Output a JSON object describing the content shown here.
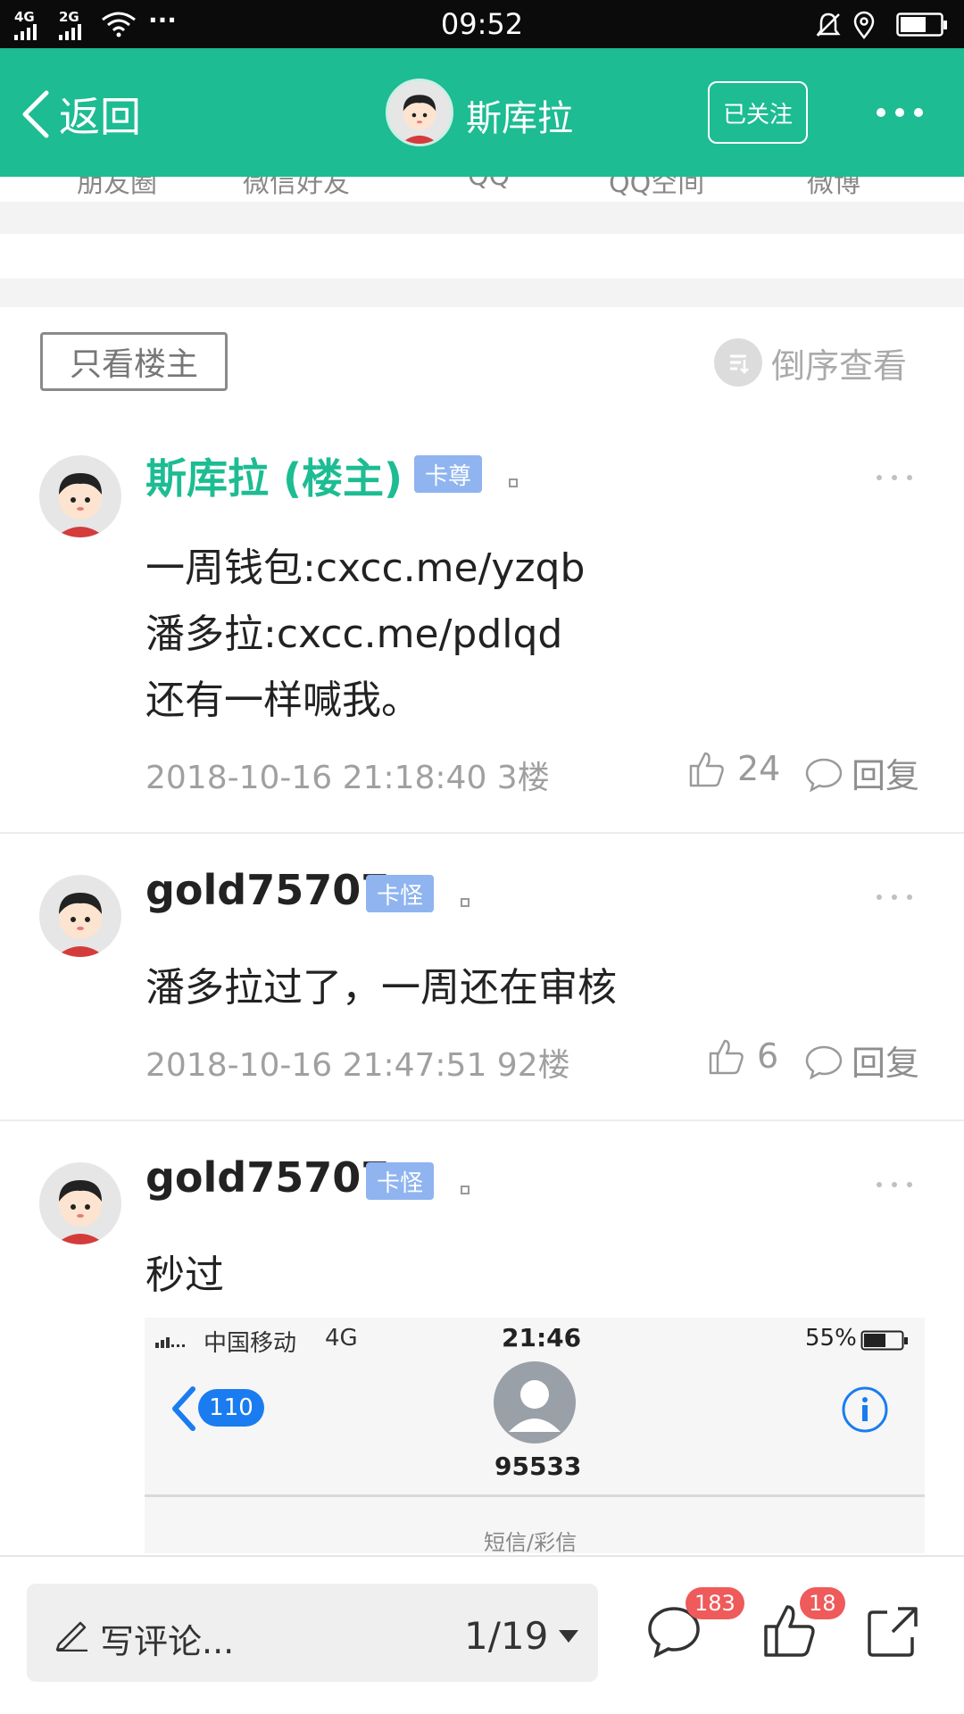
{
  "status_bar": {
    "time": "09:52",
    "network_1": "4G",
    "network_2": "2G",
    "dots": "···"
  },
  "header": {
    "back_label": "返回",
    "user_name": "斯库拉",
    "follow_label": "已关注"
  },
  "share_targets": [
    "朋友圈",
    "微信好友",
    "QQ",
    "QQ空间",
    "微博"
  ],
  "filter": {
    "only_owner_label": "只看楼主",
    "reverse_label": "倒序查看"
  },
  "posts": [
    {
      "name": "斯库拉 (楼主)",
      "badge": "卡尊",
      "lines": [
        "一周钱包:cxcc.me/yzqb",
        "潘多拉:cxcc.me/pdlqd",
        "还有一样喊我。"
      ],
      "meta": "2018-10-16 21:18:40  3楼",
      "likes": "24",
      "reply_label": "回复"
    },
    {
      "name": "gold75707",
      "badge": "卡怪",
      "lines": [
        "潘多拉过了，一周还在审核"
      ],
      "meta": "2018-10-16 21:47:51  92楼",
      "likes": "6",
      "reply_label": "回复"
    },
    {
      "name": "gold75707",
      "badge": "卡怪",
      "lines": [
        "秒过"
      ]
    }
  ],
  "embedded_screenshot": {
    "carrier": "中国移动",
    "network": "4G",
    "time": "21:46",
    "battery": "55%",
    "back_count": "110",
    "contact": "95533",
    "footer_label": "短信/彩信"
  },
  "bottom_bar": {
    "comment_placeholder": "写评论...",
    "page_indicator": "1/19",
    "comment_count": "183",
    "like_count": "18"
  },
  "colors": {
    "brand": "#1dbc93",
    "badge": "#8fb4ef",
    "count_badge": "#ef5a5a"
  }
}
